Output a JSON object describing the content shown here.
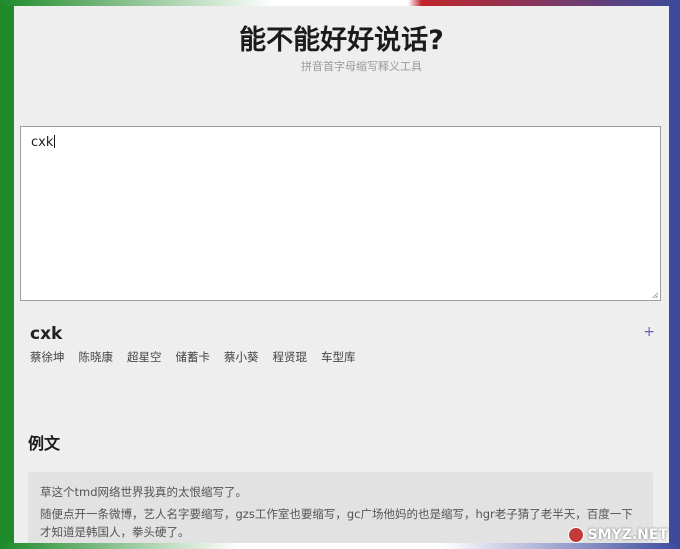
{
  "header": {
    "title": "能不能好好说话?",
    "subtitle": "拼音首字母缩写释义工具"
  },
  "input": {
    "value": "cxk"
  },
  "result": {
    "abbr": "cxk",
    "plus_label": "+",
    "candidates": [
      "蔡徐坤",
      "陈晓康",
      "超星空",
      "储蓄卡",
      "蔡小葵",
      "程贤琨",
      "车型库"
    ]
  },
  "examples": {
    "heading": "例文",
    "paragraphs": [
      "草这个tmd网络世界我真的太恨缩写了。",
      "随便点开一条微博，艺人名字要缩写，gzs工作室也要缩写，gc广场他妈的也是缩写，hgr老子猜了老半天，百度一下才知道是韩国人，拳头硬了。"
    ]
  },
  "watermark": {
    "text": "SMYZ.NET"
  },
  "colors": {
    "frame_green": "#1f8a2a",
    "frame_blue": "#3b4a9c",
    "frame_red": "#c0262b",
    "page_bg": "#eeeeef",
    "accent_plus": "#6a5fb5"
  }
}
